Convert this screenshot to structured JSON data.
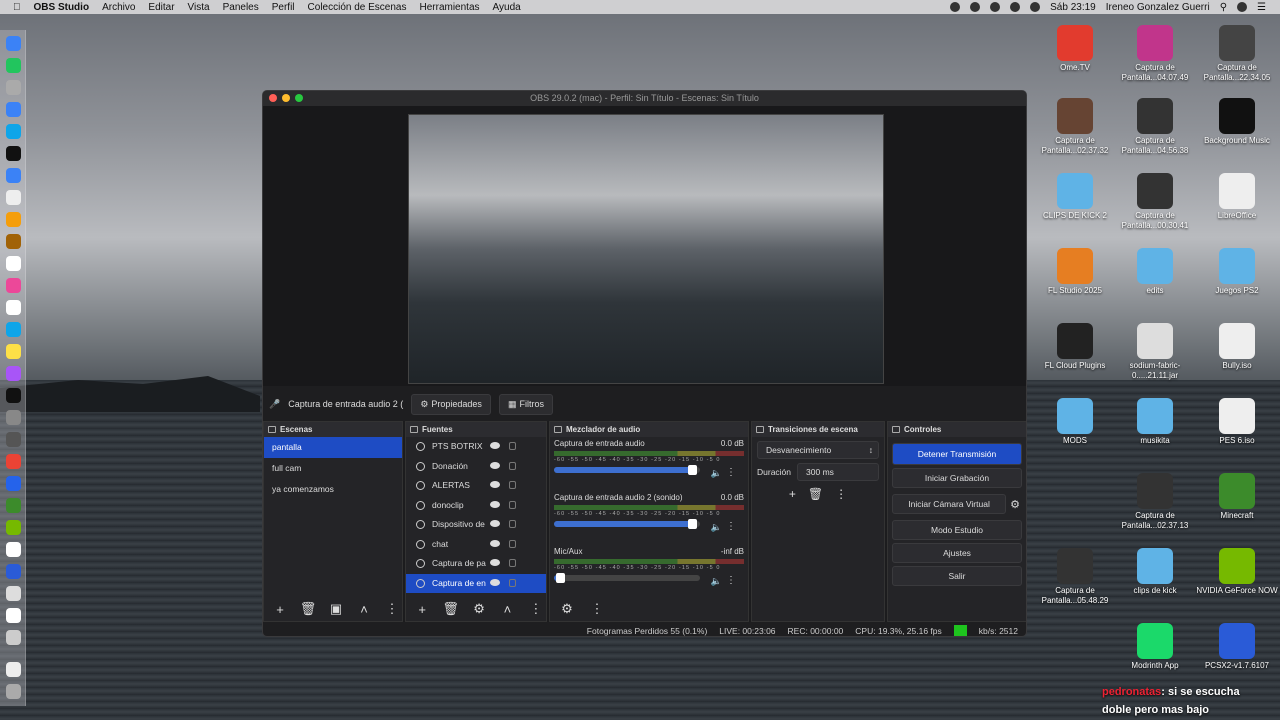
{
  "menubar": {
    "app": "OBS Studio",
    "items": [
      "Archivo",
      "Editar",
      "Vista",
      "Paneles",
      "Perfil",
      "Colección de Escenas",
      "Herramientas",
      "Ayuda"
    ],
    "clock": "Sáb 23:19",
    "user": "Ireneo Gonzalez Guerri"
  },
  "desktop_icons": [
    {
      "label": "Ome.TV",
      "color": "#e23b2e"
    },
    {
      "label": "Captura de Pantalla...04.07.49",
      "color": "#c1358b"
    },
    {
      "label": "Captura de Pantalla...22.34.05",
      "color": "#444"
    },
    {
      "label": "Captura de Pantalla...02.37.32",
      "color": "#664433"
    },
    {
      "label": "Captura de Pantalla...04.56.38",
      "color": "#333"
    },
    {
      "label": "Background Music",
      "color": "#111"
    },
    {
      "label": "CLIPS DE KICK 2",
      "color": "#5fb3e6"
    },
    {
      "label": "Captura de Pantalla...00.30.41",
      "color": "#333"
    },
    {
      "label": "LibreOffice",
      "color": "#eee"
    },
    {
      "label": "FL Studio 2025",
      "color": "#e67e22"
    },
    {
      "label": "edits",
      "color": "#5fb3e6"
    },
    {
      "label": "Juegos PS2",
      "color": "#5fb3e6"
    },
    {
      "label": "FL Cloud Plugins",
      "color": "#222"
    },
    {
      "label": "sodium-fabric-0.....21.11.jar",
      "color": "#ddd"
    },
    {
      "label": "Bully.iso",
      "color": "#eee"
    },
    {
      "label": "MODS",
      "color": "#5fb3e6"
    },
    {
      "label": "musikita",
      "color": "#5fb3e6"
    },
    {
      "label": "PES 6.iso",
      "color": "#eee"
    },
    {
      "label": "Captura de Pantalla...02.37.13",
      "color": "#333"
    },
    {
      "label": "Minecraft",
      "color": "#3c8b2b"
    },
    {
      "label": "Captura de Pantalla...05.48.29",
      "color": "#333"
    },
    {
      "label": "clips de kick",
      "color": "#5fb3e6"
    },
    {
      "label": "NVIDIA GeForce NOW",
      "color": "#76b900"
    },
    {
      "label": "Modrinth App",
      "color": "#1bd96a"
    },
    {
      "label": "PCSX2-v1.7.6107",
      "color": "#2a5bd7"
    }
  ],
  "window": {
    "title": "OBS 29.0.2 (mac) - Perfil: Sin Título - Escenas: Sin Título"
  },
  "context": {
    "source": "Captura de entrada audio 2 (",
    "props": "Propiedades",
    "filters": "Filtros"
  },
  "scenes": {
    "title": "Escenas",
    "items": [
      "pantalla",
      "full cam",
      "ya comenzamos"
    ]
  },
  "sources": {
    "title": "Fuentes",
    "items": [
      "PTS BOTRIX",
      "Donación",
      "ALERTAS",
      "donoclip",
      "Dispositivo de",
      "chat",
      "Captura de pa",
      "Captura de en"
    ]
  },
  "mixer": {
    "title": "Mezclador de audio",
    "ticks": "-60 -55 -50 -45 -40 -35 -30 -25 -20 -15 -10 -5 0",
    "channels": [
      {
        "name": "Captura de entrada audio",
        "db": "0.0 dB",
        "level": 0.95
      },
      {
        "name": "Captura de entrada audio 2 (sonido)",
        "db": "0.0 dB",
        "level": 0.95
      },
      {
        "name": "Mic/Aux",
        "db": "-inf dB",
        "level": 0.05
      }
    ]
  },
  "transitions": {
    "title": "Transiciones de escena",
    "type": "Desvanecimiento",
    "duration_label": "Duración",
    "duration": "300 ms"
  },
  "controls": {
    "title": "Controles",
    "stream": "Detener Transmisión",
    "record": "Iniciar Grabación",
    "vcam": "Iniciar Cámara Virtual",
    "studio": "Modo Estudio",
    "settings": "Ajustes",
    "exit": "Salir"
  },
  "status": {
    "dropped": "Fotogramas Perdidos 55 (0.1%)",
    "live": "LIVE: 00:23:06",
    "rec": "REC: 00:00:00",
    "cpu": "CPU: 19.3%, 25.16 fps",
    "kbs": "kb/s: 2512"
  },
  "chat": {
    "user": "pedronatas",
    "message": ": si se escucha",
    "line2": "doble pero mas bajo"
  }
}
